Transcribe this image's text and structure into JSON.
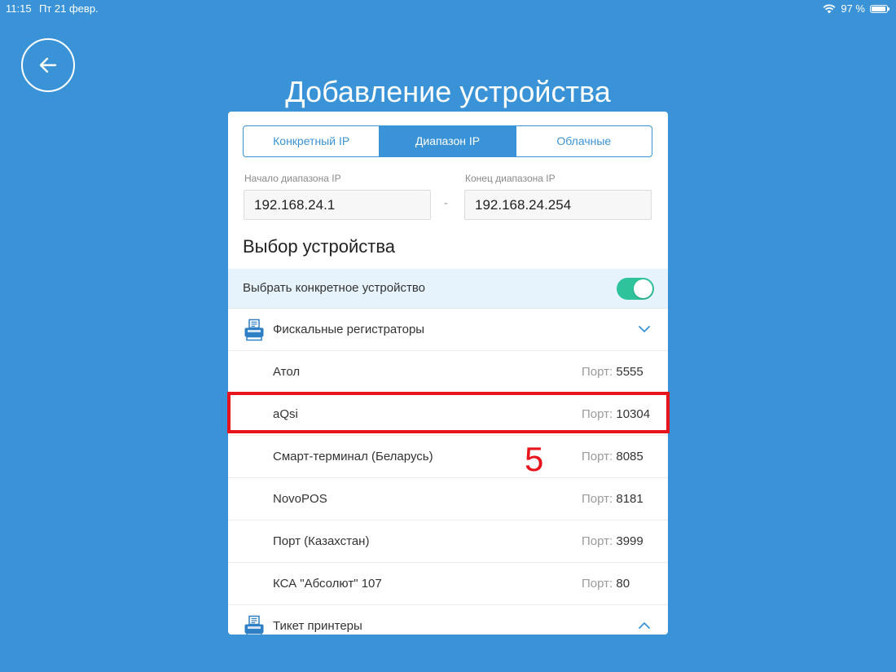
{
  "status_bar": {
    "time": "11:15",
    "date": "Пт 21 февр.",
    "battery": "97 %"
  },
  "header": {
    "title": "Добавление устройства",
    "back_icon": "arrow-left-icon"
  },
  "tabs": [
    {
      "label": "Конкретный IP",
      "active": false
    },
    {
      "label": "Диапазон IP",
      "active": true
    },
    {
      "label": "Облачные",
      "active": false
    }
  ],
  "range": {
    "start_label": "Начало диапазона IP",
    "start_value": "192.168.24.1",
    "separator": "-",
    "end_label": "Конец диапазона IP",
    "end_value": "192.168.24.254"
  },
  "device_selection": {
    "title": "Выбор устройства",
    "toggle_label": "Выбрать конкретное устройство",
    "toggle_on": true
  },
  "groups": [
    {
      "label": "Фискальные регистраторы",
      "icon": "receipt-printer-icon",
      "expanded": true,
      "devices": [
        {
          "name": "Атол",
          "port_label": "Порт:",
          "port": "5555"
        },
        {
          "name": "aQsi",
          "port_label": "Порт:",
          "port": "10304"
        },
        {
          "name": "Смарт-терминал (Беларусь)",
          "port_label": "Порт:",
          "port": "8085"
        },
        {
          "name": "NovoPOS",
          "port_label": "Порт:",
          "port": "8181"
        },
        {
          "name": "Порт (Казахстан)",
          "port_label": "Порт:",
          "port": "3999"
        },
        {
          "name": "КСА \"Абсолют\" 107",
          "port_label": "Порт:",
          "port": "80"
        }
      ]
    },
    {
      "label": "Тикет принтеры",
      "icon": "receipt-printer-icon",
      "expanded": false,
      "devices": []
    }
  ],
  "annotation": {
    "number": "5",
    "color": "#e8141b"
  },
  "colors": {
    "background": "#3a93d6",
    "accent": "#3a93d6",
    "toggle": "#2fc39b"
  }
}
